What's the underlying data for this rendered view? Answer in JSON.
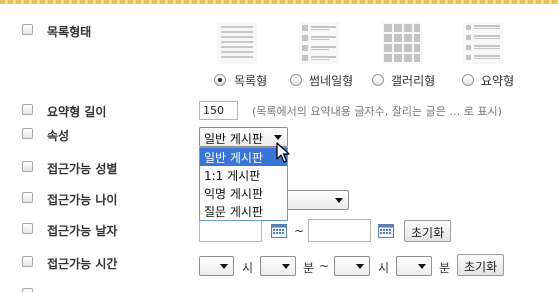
{
  "fields": {
    "list_type": "목록형태",
    "summary_length": "요약형 길이",
    "attribute": "속성",
    "access_gender": "접근가능 성별",
    "access_age": "접근가능 나이",
    "access_date": "접근가능 날자",
    "access_time": "접근가능 시간"
  },
  "list_type_options": [
    {
      "label": "목록형",
      "icon": "list-layout-icon",
      "selected": true
    },
    {
      "label": "썸네일형",
      "icon": "thumbnail-layout-icon",
      "selected": false
    },
    {
      "label": "갤러리형",
      "icon": "gallery-layout-icon",
      "selected": false
    },
    {
      "label": "요약형",
      "icon": "summary-layout-icon",
      "selected": false
    }
  ],
  "summary": {
    "value": "150",
    "hint": "(목록에서의 요약내용 글자수, 잘리는 글은 … 로 표시)"
  },
  "attribute_select": {
    "selected": "일반 게시판",
    "options": [
      "일반 게시판",
      "1:1 게시판",
      "익명 게시판",
      "질문 게시판"
    ]
  },
  "date": {
    "separator": "~",
    "reset_label": "초기화"
  },
  "time": {
    "hour_unit": "시",
    "minute_unit": "분",
    "separator": "~",
    "reset_label": "초기화"
  },
  "colors": {
    "accent": "#3875d7",
    "top_strip": "#e6c05a"
  }
}
